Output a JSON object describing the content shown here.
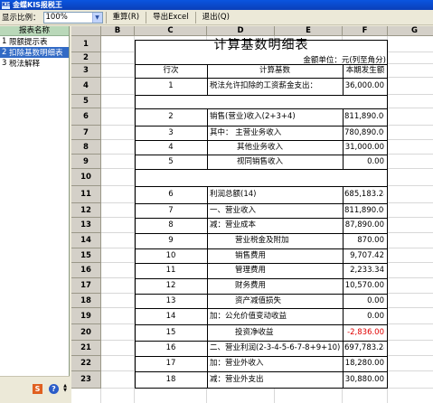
{
  "window": {
    "title": "金蝶KIS报税王"
  },
  "toolbar": {
    "zoom_label": "显示比例：",
    "zoom_value": "100%",
    "reset": "重算(R)",
    "export": "导出Excel",
    "exit": "退出(Q)"
  },
  "sidebar": {
    "header": "报表名称",
    "items": [
      {
        "num": "1",
        "label": "限额提示表"
      },
      {
        "num": "2",
        "label": "扣除基数明细表"
      },
      {
        "num": "3",
        "label": "税法解释"
      }
    ]
  },
  "sheet": {
    "columns": [
      "B",
      "C",
      "D",
      "E",
      "F",
      "G"
    ],
    "title": "计算基数明细表",
    "unit": "金额单位：元(列至角分)",
    "head": {
      "c": "行次",
      "d": "计算基数",
      "f": "本期发生额"
    },
    "rows": [
      {
        "r": "1"
      },
      {
        "r": "2"
      },
      {
        "r": "3"
      },
      {
        "r": "4",
        "c": "1",
        "d": "税法允许扣除的工资薪金支出：",
        "f": "36,000.00"
      },
      {
        "r": "5"
      },
      {
        "r": "6",
        "c": "2",
        "d": "销售(营业)收入(2+3+4)",
        "f": "811,890.00"
      },
      {
        "r": "7",
        "c": "3",
        "d": "其中：  主营业务收入",
        "f": "780,890.00"
      },
      {
        "r": "8",
        "c": "4",
        "d": "其他业务收入",
        "f": "31,000.00"
      },
      {
        "r": "9",
        "c": "5",
        "d": "视同销售收入",
        "f": "0.00"
      },
      {
        "r": "10"
      },
      {
        "r": "11",
        "c": "6",
        "d": "利润总额(14)",
        "f": "685,183.24"
      },
      {
        "r": "12",
        "c": "7",
        "d": "一、营业收入",
        "f": "811,890.00"
      },
      {
        "r": "13",
        "c": "8",
        "d": "减：营业成本",
        "f": "87,890.00"
      },
      {
        "r": "14",
        "c": "9",
        "d": "营业税金及附加",
        "f": "870.00"
      },
      {
        "r": "15",
        "c": "10",
        "d": "销售费用",
        "f": "9,707.42"
      },
      {
        "r": "16",
        "c": "11",
        "d": "管理费用",
        "f": "2,233.34"
      },
      {
        "r": "17",
        "c": "12",
        "d": "财务费用",
        "f": "10,570.00"
      },
      {
        "r": "18",
        "c": "13",
        "d": "资产减值损失",
        "f": "0.00"
      },
      {
        "r": "19",
        "c": "14",
        "d": "加：公允价值变动收益",
        "f": "0.00"
      },
      {
        "r": "20",
        "c": "15",
        "d": "投资净收益",
        "f": "-2,836.00"
      },
      {
        "r": "21",
        "c": "16",
        "d": "二、营业利润(2-3-4-5-6-7-8+9+10)",
        "f": "697,783.24"
      },
      {
        "r": "22",
        "c": "17",
        "d": "加：营业外收入",
        "f": "18,280.00"
      },
      {
        "r": "23",
        "c": "18",
        "d": "减：营业外支出",
        "f": "30,880.00"
      }
    ]
  },
  "colors": {
    "selection": "#316ac5",
    "negative": "#e00000",
    "panel_header": "#b9d8b9"
  }
}
